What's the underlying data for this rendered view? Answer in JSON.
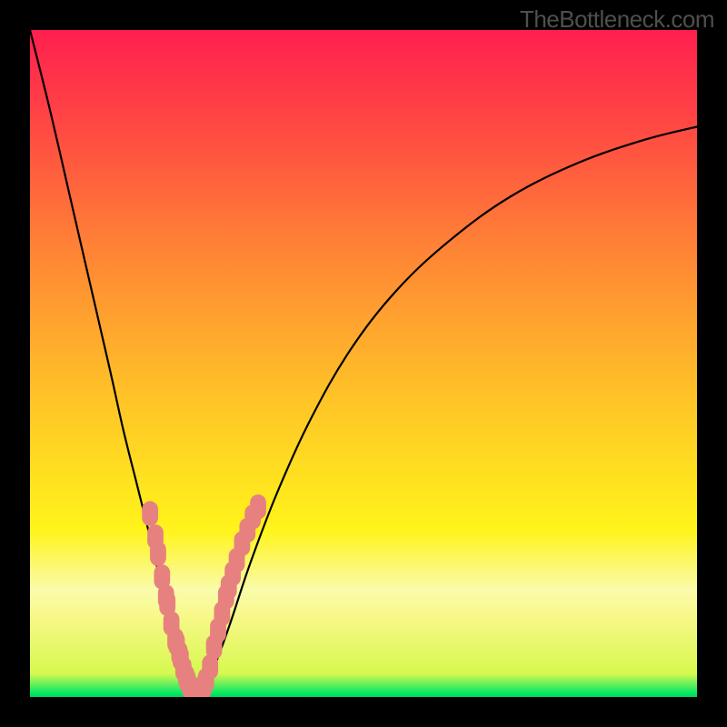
{
  "watermark": "TheBottleneck.com",
  "chart_data": {
    "type": "line",
    "title": "",
    "xlabel": "",
    "ylabel": "",
    "xlim": [
      0,
      100
    ],
    "ylim": [
      0,
      100
    ],
    "grid": false,
    "background_gradient": {
      "stops": [
        {
          "offset": 0,
          "color": "#ff1f4f"
        },
        {
          "offset": 0.15,
          "color": "#ff4a43"
        },
        {
          "offset": 0.35,
          "color": "#ff8a34"
        },
        {
          "offset": 0.55,
          "color": "#ffc327"
        },
        {
          "offset": 0.75,
          "color": "#fff41b"
        },
        {
          "offset": 0.84,
          "color": "#fafbac"
        },
        {
          "offset": 0.88,
          "color": "#f8f888"
        },
        {
          "offset": 0.965,
          "color": "#d6f84f"
        },
        {
          "offset": 0.995,
          "color": "#00e765"
        },
        {
          "offset": 1.0,
          "color": "#00d45e"
        }
      ]
    },
    "series": [
      {
        "name": "left-arm",
        "stroke": "#000000",
        "x": [
          0.0,
          3.0,
          6.0,
          9.0,
          12.0,
          14.0,
          16.0,
          17.5,
          18.7,
          19.7,
          20.6,
          21.4,
          22.2,
          23.0,
          23.8,
          25.0
        ],
        "y": [
          100.0,
          88.0,
          75.0,
          62.0,
          49.0,
          40.0,
          32.0,
          26.0,
          21.0,
          16.5,
          12.5,
          9.0,
          6.0,
          3.5,
          1.5,
          0.0
        ]
      },
      {
        "name": "right-arm",
        "stroke": "#000000",
        "x": [
          25.0,
          26.0,
          27.8,
          30.0,
          33.0,
          37.0,
          42.0,
          48.0,
          55.0,
          63.0,
          72.0,
          82.0,
          92.0,
          100.0
        ],
        "y": [
          0.0,
          1.5,
          5.0,
          11.0,
          20.0,
          30.5,
          41.5,
          52.0,
          61.0,
          68.5,
          75.0,
          80.0,
          83.5,
          85.5
        ]
      }
    ],
    "markers": {
      "name": "highlight-points",
      "fill": "#e7817f",
      "radius": 2.2,
      "points": [
        {
          "x": 18.0,
          "y": 27.5
        },
        {
          "x": 18.8,
          "y": 24.0
        },
        {
          "x": 19.2,
          "y": 21.5
        },
        {
          "x": 19.8,
          "y": 18.0
        },
        {
          "x": 20.4,
          "y": 15.0
        },
        {
          "x": 20.6,
          "y": 14.0
        },
        {
          "x": 21.2,
          "y": 11.0
        },
        {
          "x": 21.8,
          "y": 8.5
        },
        {
          "x": 22.0,
          "y": 8.0
        },
        {
          "x": 22.4,
          "y": 6.5
        },
        {
          "x": 22.6,
          "y": 5.8
        },
        {
          "x": 23.0,
          "y": 4.2
        },
        {
          "x": 23.4,
          "y": 3.0
        },
        {
          "x": 23.6,
          "y": 2.5
        },
        {
          "x": 24.0,
          "y": 1.5
        },
        {
          "x": 24.4,
          "y": 0.8
        },
        {
          "x": 24.8,
          "y": 0.3
        },
        {
          "x": 25.2,
          "y": 0.3
        },
        {
          "x": 25.6,
          "y": 0.8
        },
        {
          "x": 26.0,
          "y": 1.5
        },
        {
          "x": 26.4,
          "y": 2.5
        },
        {
          "x": 27.0,
          "y": 4.5
        },
        {
          "x": 27.6,
          "y": 7.5
        },
        {
          "x": 28.2,
          "y": 10.0
        },
        {
          "x": 28.8,
          "y": 12.5
        },
        {
          "x": 29.4,
          "y": 15.0
        },
        {
          "x": 29.8,
          "y": 16.5
        },
        {
          "x": 30.4,
          "y": 18.5
        },
        {
          "x": 31.0,
          "y": 20.5
        },
        {
          "x": 31.8,
          "y": 23.0
        },
        {
          "x": 32.6,
          "y": 25.0
        },
        {
          "x": 33.4,
          "y": 27.0
        },
        {
          "x": 34.2,
          "y": 28.5
        }
      ]
    }
  }
}
